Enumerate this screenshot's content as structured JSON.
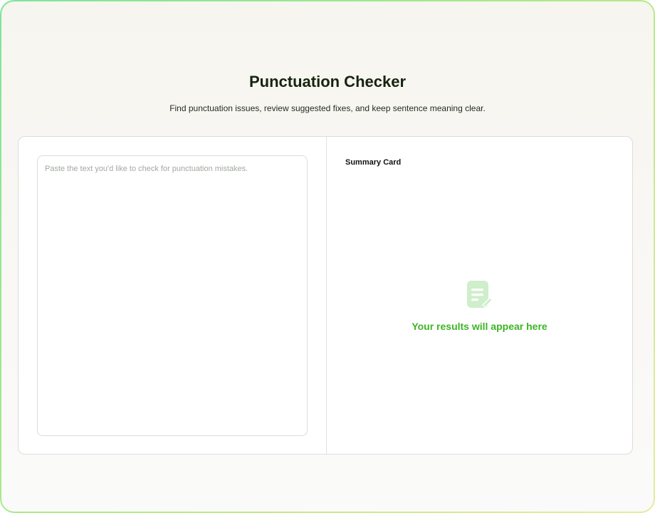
{
  "header": {
    "title": "Punctuation Checker",
    "subtitle": "Find punctuation issues, review suggested fixes, and keep sentence meaning clear."
  },
  "input": {
    "value": "",
    "placeholder": "Paste the text you'd like to check for punctuation mistakes."
  },
  "summary": {
    "title": "Summary Card",
    "empty_message": "Your results will appear here",
    "empty_icon": "document-edit-icon"
  },
  "colors": {
    "accent": "#3cb524",
    "icon": "#cfeecb",
    "frame_start": "#7ee59a",
    "frame_end": "#e6ec9e"
  }
}
